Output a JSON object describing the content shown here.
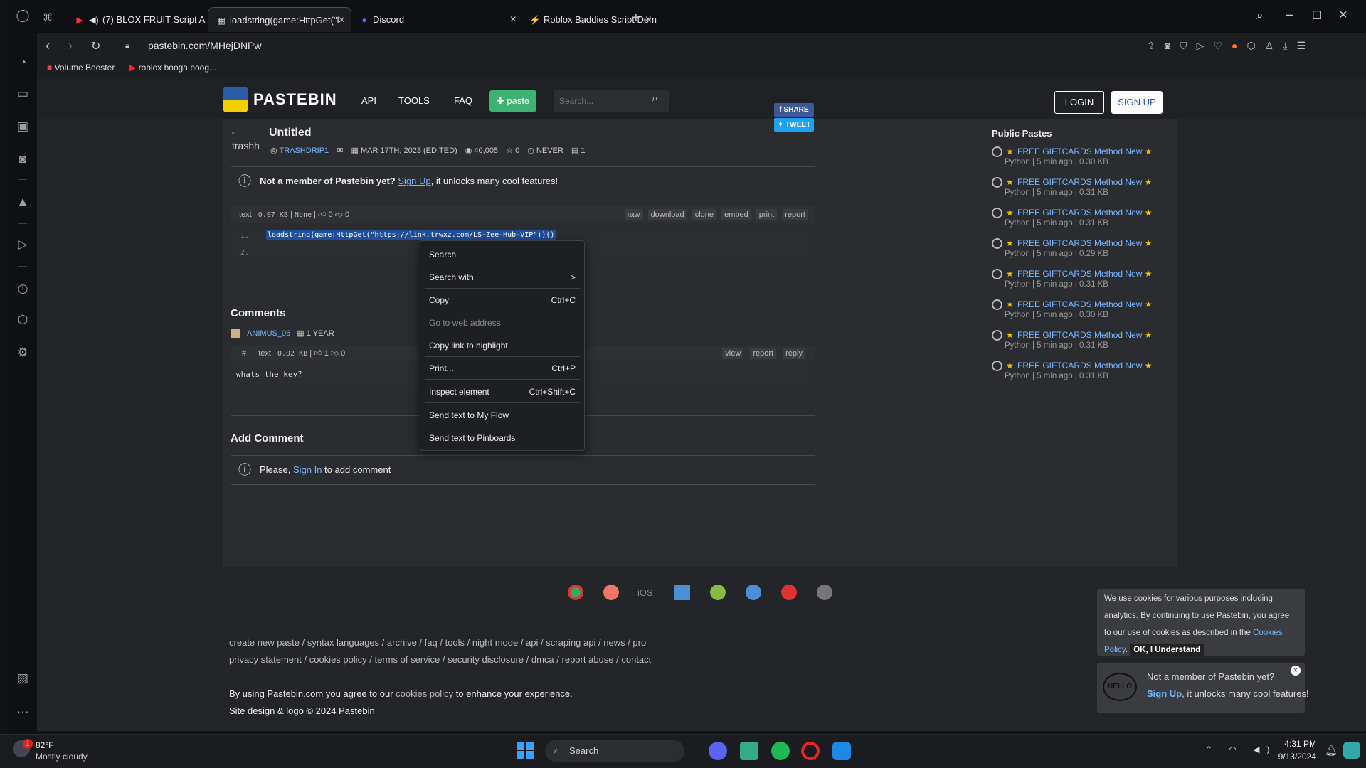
{
  "tabs": [
    {
      "label": "(7) BLOX FRUIT Script A",
      "icon": "youtube-icon"
    },
    {
      "label": "loadstring(game:HttpGet(\"l",
      "icon": "pastebin-icon"
    },
    {
      "label": "Discord",
      "icon": "discord-icon"
    },
    {
      "label": "Roblox Baddies Script Dem",
      "icon": "link-icon"
    }
  ],
  "address": "pastebin.com/MHejDNPw",
  "bookmarks": [
    {
      "label": "Volume Booster"
    },
    {
      "label": "roblox booga boog..."
    }
  ],
  "site": {
    "logo_text": "PASTEBIN",
    "nav": [
      "API",
      "TOOLS",
      "FAQ"
    ],
    "paste_btn": "paste",
    "search_placeholder": "Search...",
    "login": "LOGIN",
    "signup": "SIGN UP"
  },
  "paste": {
    "avatar_alt": "trashh",
    "title": "Untitled",
    "author": "TRASHDRIP1",
    "date": "MAR 17TH, 2023 (EDITED)",
    "views": "40,005",
    "stars": "0",
    "expire": "NEVER",
    "comments_count": "1",
    "share": "SHARE",
    "tweet": "TWEET",
    "notice_bold": "Not a member of Pastebin yet?",
    "notice_link": "Sign Up",
    "notice_rest": ", it unlocks many cool features!",
    "format": "text",
    "size": "0.07 KB",
    "category": "None",
    "likes": "0",
    "dislikes": "0",
    "actions": [
      "raw",
      "download",
      "clone",
      "embed",
      "print",
      "report"
    ],
    "lines": [
      {
        "n": "1.",
        "code": "loadstring(game:HttpGet(\"https://link.trwxz.com/LS-Zee-Hub-VIP\"))()"
      },
      {
        "n": "2.",
        "code": ""
      }
    ]
  },
  "comments": {
    "heading": "Comments",
    "author": "ANIMUS_06",
    "age": "1 YEAR",
    "hash": "#",
    "format": "text",
    "size": "0.02 KB",
    "likes": "1",
    "dislikes": "0",
    "actions": [
      "view",
      "report",
      "reply"
    ],
    "body": "whats the key?"
  },
  "add_comment": {
    "heading": "Add Comment",
    "please": "Please,",
    "sign_in": "Sign In",
    "rest": "to add comment"
  },
  "public_pastes": {
    "heading": "Public Pastes",
    "items": [
      {
        "title": "FREE GIFTCARDS Method New",
        "meta": "Python | 5 min ago | 0.30 KB"
      },
      {
        "title": "FREE GIFTCARDS Method New",
        "meta": "Python | 5 min ago | 0.31 KB"
      },
      {
        "title": "FREE GIFTCARDS Method New",
        "meta": "Python | 5 min ago | 0.31 KB"
      },
      {
        "title": "FREE GIFTCARDS Method New",
        "meta": "Python | 5 min ago | 0.29 KB"
      },
      {
        "title": "FREE GIFTCARDS Method New",
        "meta": "Python | 5 min ago | 0.31 KB"
      },
      {
        "title": "FREE GIFTCARDS Method New",
        "meta": "Python | 5 min ago | 0.30 KB"
      },
      {
        "title": "FREE GIFTCARDS Method New",
        "meta": "Python | 5 min ago | 0.31 KB"
      },
      {
        "title": "FREE GIFTCARDS Method New",
        "meta": "Python | 5 min ago | 0.31 KB"
      }
    ]
  },
  "context_menu": [
    {
      "label": "Search",
      "shortcut": "",
      "disabled": false
    },
    {
      "label": "Search with",
      "shortcut": ">",
      "disabled": false
    },
    {
      "label": "Copy",
      "shortcut": "Ctrl+C",
      "disabled": false
    },
    {
      "label": "Go to web address",
      "shortcut": "",
      "disabled": true
    },
    {
      "label": "Copy link to highlight",
      "shortcut": "",
      "disabled": false
    },
    {
      "label": "Print...",
      "shortcut": "Ctrl+P",
      "disabled": false
    },
    {
      "label": "Inspect element",
      "shortcut": "Ctrl+Shift+C",
      "disabled": false
    },
    {
      "label": "Send text to My Flow",
      "shortcut": "",
      "disabled": false
    },
    {
      "label": "Send text to Pinboards",
      "shortcut": "",
      "disabled": false
    }
  ],
  "platforms": [
    "chrome",
    "firefox",
    "iOS",
    "windows",
    "android",
    "x",
    "opera",
    "ubuntu"
  ],
  "footer": {
    "row1": [
      "create new paste",
      "syntax languages",
      "archive",
      "faq",
      "tools",
      "night mode",
      "api",
      "scraping api",
      "news",
      "pro"
    ],
    "row2": [
      "privacy statement",
      "cookies policy",
      "terms of service",
      "security disclosure",
      "dmca",
      "report abuse",
      "contact"
    ],
    "agree_pre": "By using Pastebin.com you agree to our",
    "agree_link": "cookies policy",
    "agree_post": "to enhance your experience.",
    "copyright": "Site design & logo © 2024 Pastebin"
  },
  "cookie": {
    "text": "We use cookies for various purposes including analytics. By continuing to use Pastebin, you agree to our use of cookies as described in the",
    "link": "Cookies Policy",
    "button": "OK, I Understand"
  },
  "hello_popup": {
    "badge": "HELLO",
    "line1": "Not a member of Pastebin yet?",
    "link": "Sign Up",
    "rest": ", it unlocks many cool features!"
  },
  "taskbar": {
    "weather_temp": "82°F",
    "weather_desc": "Mostly cloudy",
    "weather_badge": "1",
    "search": "Search",
    "time": "4:31 PM",
    "date": "9/13/2024"
  },
  "colors": {
    "accent_green": "#3cb371",
    "link_blue": "#7ab6ff",
    "selection": "#1f4f9a",
    "facebook": "#3b5998",
    "twitter": "#1da1f2"
  }
}
